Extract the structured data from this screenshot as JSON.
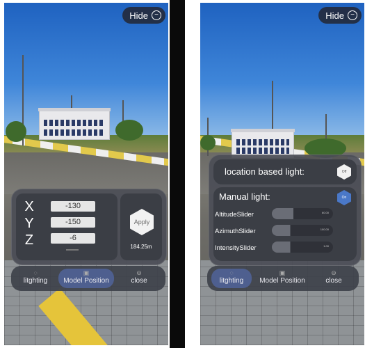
{
  "hide_label": "Hide",
  "hide_icon": "minus-circle-icon",
  "left": {
    "position": {
      "axes": [
        {
          "label": "X",
          "value": "-130"
        },
        {
          "label": "Y",
          "value": "-150"
        },
        {
          "label": "Z",
          "value": "-6"
        }
      ],
      "apply_label": "Apply",
      "distance": "184.25m"
    }
  },
  "right": {
    "location_light_label": "location based light:",
    "location_toggle": "Off",
    "manual_light_label": "Manual light:",
    "manual_toggle": "On",
    "sliders": [
      {
        "label": "AltitudeSlider",
        "value": "60.00",
        "level": 0.35
      },
      {
        "label": "AzimuthSlider",
        "value": "100.00",
        "level": 0.3
      },
      {
        "label": "IntensitySlider",
        "value": "1.00",
        "level": 0.3
      }
    ]
  },
  "tabs": {
    "lighting": "litghting",
    "model_position": "Model Position",
    "close": "close"
  },
  "colors": {
    "active_tab": "#50629a",
    "toggle_on": "#4a78c8",
    "toggle_off": "#f2f2f2"
  }
}
